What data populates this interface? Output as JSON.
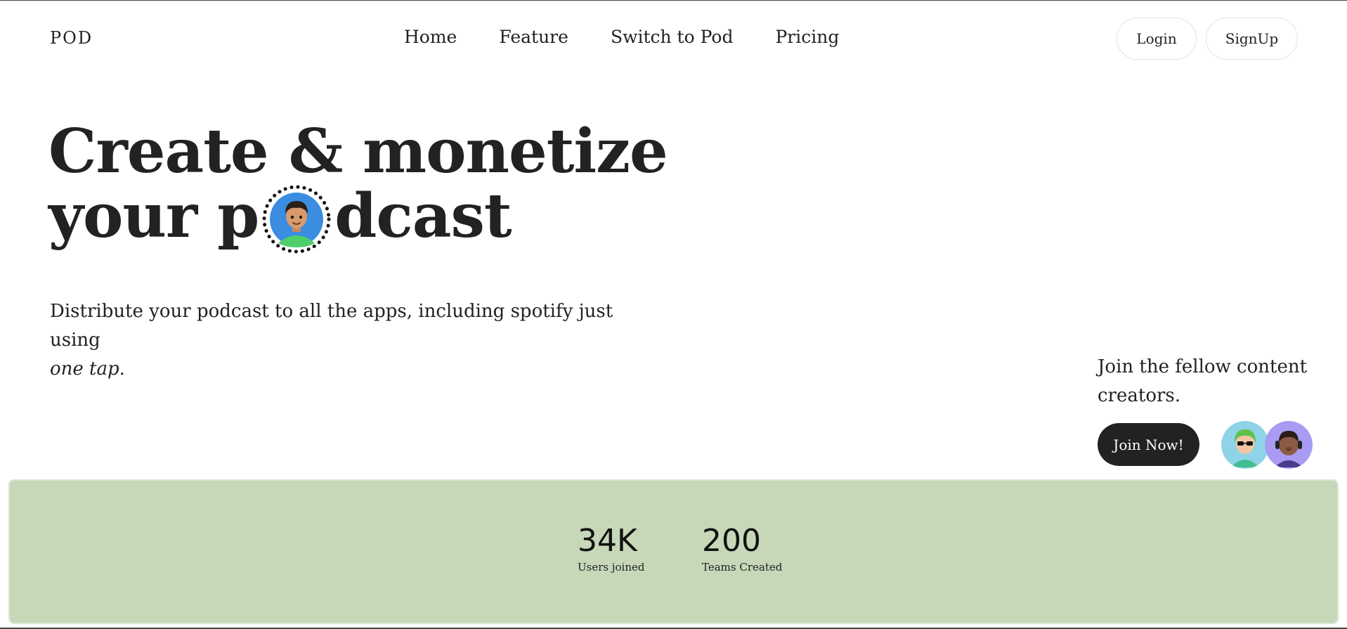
{
  "header": {
    "logo": "POD",
    "nav": [
      "Home",
      "Feature",
      "Switch to Pod",
      "Pricing"
    ],
    "login_label": "Login",
    "signup_label": "SignUp"
  },
  "hero": {
    "title_line1": "Create & monetize",
    "title_line2_before": "your p",
    "title_line2_after": "dcast",
    "subtitle_main": "Distribute your podcast to all the apps, including spotify just using",
    "subtitle_emphasis": "one tap",
    "subtitle_end": "."
  },
  "join": {
    "text": "Join the fellow content creators.",
    "button_label": "Join Now!"
  },
  "stats": [
    {
      "value": "34K",
      "label": "Users joined"
    },
    {
      "value": "200",
      "label": "Teams Created"
    }
  ],
  "colors": {
    "accent_band": "#c6d8b8",
    "dark_button": "#222222",
    "avatar_bg_blue": "#3a8de0",
    "creator_bg_teal": "#8fd3e8",
    "creator_bg_purple": "#a99af2"
  }
}
